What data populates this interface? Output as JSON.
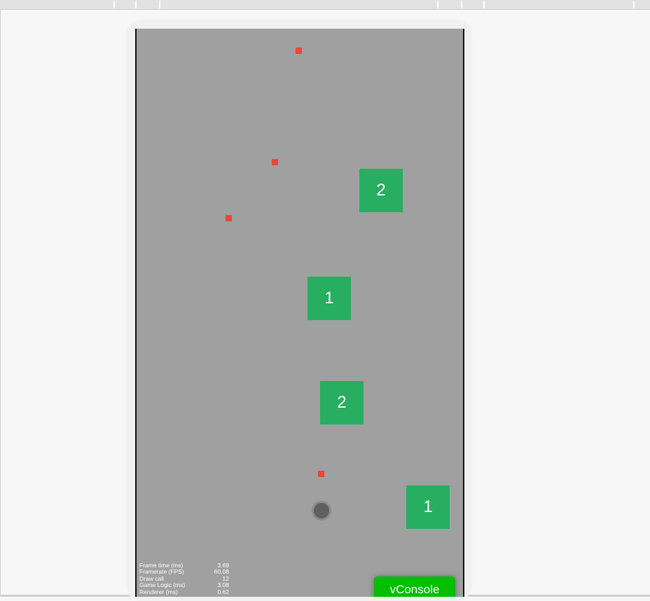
{
  "game": {
    "blocks": [
      {
        "label": "2"
      },
      {
        "label": "1"
      },
      {
        "label": "2"
      },
      {
        "label": "1"
      }
    ],
    "stats": [
      {
        "label": "Frame time (ms)",
        "value": "3.69"
      },
      {
        "label": "Framerate (FPS)",
        "value": "60.08"
      },
      {
        "label": "Draw call",
        "value": "12"
      },
      {
        "label": "Game Logic (ms)",
        "value": "3.08"
      },
      {
        "label": "Renderer (ms)",
        "value": "0.62"
      }
    ],
    "vconsole_label": "vConsole"
  },
  "colors": {
    "background": "#a0a0a0",
    "block": "#27ae60",
    "bullet": "#e8473a",
    "player": "#5f5f5f",
    "vconsole": "#04be02"
  }
}
